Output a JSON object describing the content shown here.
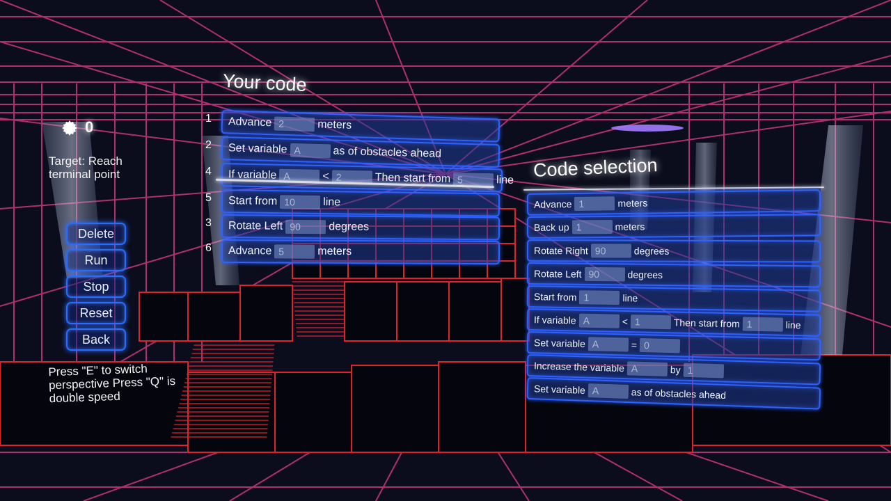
{
  "hud": {
    "score": "0",
    "target_label": "Target: Reach terminal point",
    "hint": "Press \"E\" to switch perspective Press \"Q\" is double speed",
    "buttons": [
      "Delete",
      "Run",
      "Stop",
      "Reset",
      "Back"
    ]
  },
  "your_code": {
    "title": "Your code",
    "lines": [
      {
        "no": "1",
        "parts": [
          {
            "t": "Advance"
          },
          {
            "v": "2"
          },
          {
            "t": "meters"
          }
        ]
      },
      {
        "no": "2",
        "parts": [
          {
            "t": "Set variable"
          },
          {
            "v": "A"
          },
          {
            "t": "as of obstacles ahead"
          }
        ]
      },
      {
        "no": "4",
        "parts": [
          {
            "t": "If variable"
          },
          {
            "v": "A"
          },
          {
            "t": "<"
          },
          {
            "v": "2"
          },
          {
            "t": "Then start from"
          },
          {
            "v": "5"
          },
          {
            "t": "line"
          }
        ]
      },
      {
        "no": "5",
        "parts": [
          {
            "t": "Start from"
          },
          {
            "v": "10"
          },
          {
            "t": "line"
          }
        ]
      },
      {
        "no": "3",
        "parts": [
          {
            "t": "Rotate Left"
          },
          {
            "v": "90"
          },
          {
            "t": "degrees"
          }
        ]
      },
      {
        "no": "6",
        "parts": [
          {
            "t": "Advance"
          },
          {
            "v": "5"
          },
          {
            "t": "meters"
          }
        ]
      }
    ]
  },
  "code_selection": {
    "title": "Code selection",
    "items": [
      {
        "parts": [
          {
            "t": "Advance"
          },
          {
            "v": "1"
          },
          {
            "t": "meters"
          }
        ]
      },
      {
        "parts": [
          {
            "t": "Back up"
          },
          {
            "v": "1"
          },
          {
            "t": "meters"
          }
        ]
      },
      {
        "parts": [
          {
            "t": "Rotate Right"
          },
          {
            "v": "90"
          },
          {
            "t": "degrees"
          }
        ]
      },
      {
        "parts": [
          {
            "t": "Rotate Left"
          },
          {
            "v": "90"
          },
          {
            "t": "degrees"
          }
        ]
      },
      {
        "parts": [
          {
            "t": "Start from"
          },
          {
            "v": "1"
          },
          {
            "t": "line"
          }
        ]
      },
      {
        "parts": [
          {
            "t": "If variable"
          },
          {
            "v": "A"
          },
          {
            "t": "<"
          },
          {
            "v": "1"
          },
          {
            "t": "Then start from"
          },
          {
            "v": "1"
          },
          {
            "t": "line"
          }
        ]
      },
      {
        "parts": [
          {
            "t": "Set variable"
          },
          {
            "v": "A"
          },
          {
            "t": "="
          },
          {
            "v": "0"
          }
        ]
      },
      {
        "parts": [
          {
            "t": "Increase the variable"
          },
          {
            "v": "A"
          },
          {
            "t": "by"
          },
          {
            "v": "1"
          }
        ]
      },
      {
        "parts": [
          {
            "t": "Set variable"
          },
          {
            "v": "A"
          },
          {
            "t": "as of obstacles ahead"
          }
        ]
      }
    ]
  },
  "colors": {
    "grid": "#b0306e",
    "floor_line": "#e0222e",
    "ui_blue": "#2f63ff",
    "background": "#0b0d1c"
  },
  "icons": {
    "score": "gear-icon"
  }
}
